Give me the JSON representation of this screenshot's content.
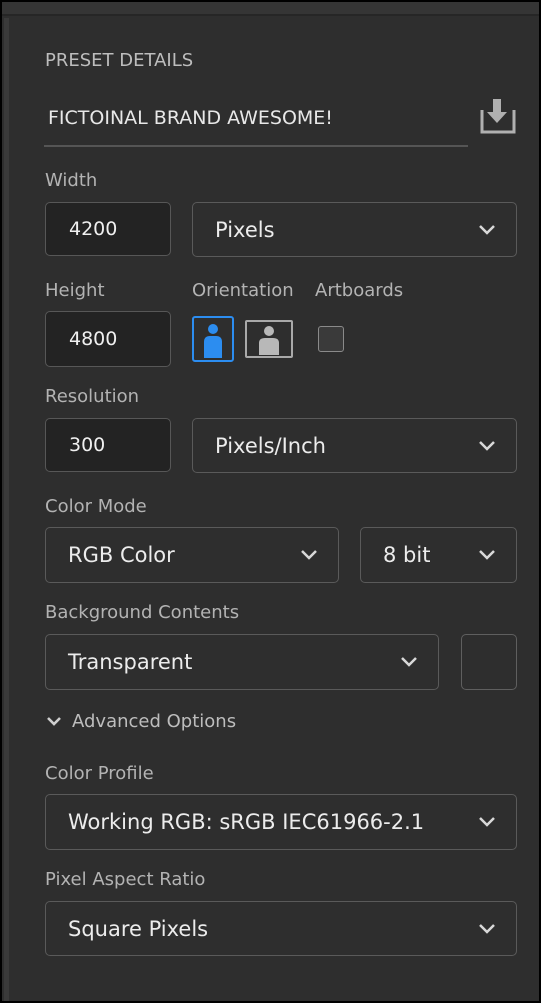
{
  "panel": {
    "title": "PRESET DETAILS",
    "preset_name": "FICTOINAL BRAND AWESOME!"
  },
  "width": {
    "label": "Width",
    "value": "4200",
    "unit": "Pixels"
  },
  "height": {
    "label": "Height",
    "value": "4800"
  },
  "orientation": {
    "label": "Orientation",
    "selected": "portrait"
  },
  "artboards": {
    "label": "Artboards",
    "checked": false
  },
  "resolution": {
    "label": "Resolution",
    "value": "300",
    "unit": "Pixels/Inch"
  },
  "color_mode": {
    "label": "Color Mode",
    "mode": "RGB Color",
    "depth": "8 bit"
  },
  "background": {
    "label": "Background Contents",
    "value": "Transparent"
  },
  "advanced": {
    "label": "Advanced Options",
    "expanded": true
  },
  "color_profile": {
    "label": "Color Profile",
    "value": "Working RGB: sRGB IEC61966-2.1"
  },
  "pixel_aspect": {
    "label": "Pixel Aspect Ratio",
    "value": "Square Pixels"
  },
  "colors": {
    "accent": "#2c8df0",
    "panel_bg": "#2e2e2e",
    "field_bg": "#232323"
  },
  "icons": {
    "save": "save-preset-icon",
    "dropdown": "chevron-down-icon",
    "portrait": "portrait-person-icon",
    "landscape": "landscape-person-icon"
  }
}
